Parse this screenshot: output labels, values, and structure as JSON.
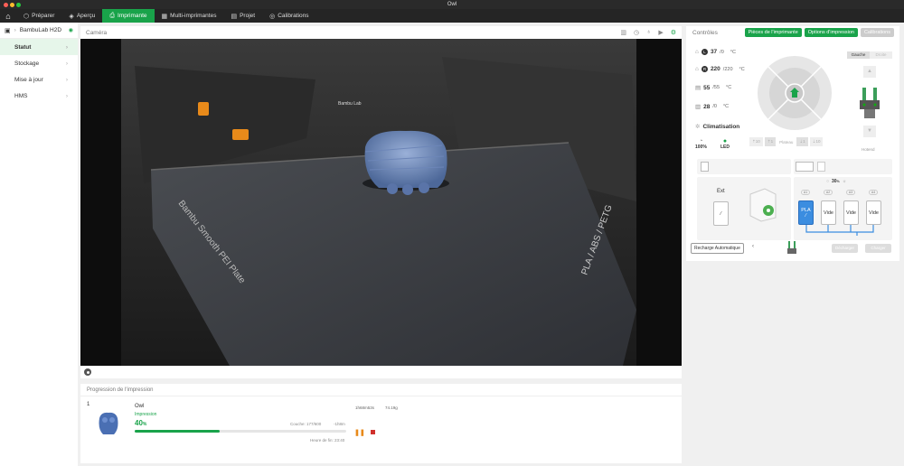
{
  "window": {
    "title": "Owl"
  },
  "nav": {
    "items": [
      {
        "label": "Préparer",
        "icon": "cube-icon"
      },
      {
        "label": "Aperçu",
        "icon": "layers-icon"
      },
      {
        "label": "Imprimante",
        "icon": "printer-icon",
        "active": true
      },
      {
        "label": "Multi-imprimantes",
        "icon": "grid-icon"
      },
      {
        "label": "Projet",
        "icon": "folder-icon"
      },
      {
        "label": "Calibrations",
        "icon": "target-icon"
      }
    ]
  },
  "sidebar": {
    "printer_name": "BambuLab H2D",
    "items": [
      {
        "label": "Statut",
        "active": true
      },
      {
        "label": "Stockage"
      },
      {
        "label": "Mise à jour"
      },
      {
        "label": "HMS"
      }
    ]
  },
  "camera": {
    "title": "Caméra",
    "bed_label": "Bambu Smooth PEI Plate",
    "bed_material": "PLA / ABS / PETG",
    "chamber_brand": "Bambu Lab"
  },
  "progress": {
    "title": "Progression de l'impression",
    "index": "1",
    "name": "Owl",
    "status": "Impression",
    "percent": "40",
    "percent_unit": "%",
    "percent_value": 40,
    "layer": "Couche: 177/600",
    "remaining": "-1h8m",
    "elapsed": "1h68m53s",
    "weight": "74.19g",
    "end_time": "Heure de fin: 23:40"
  },
  "controls": {
    "title": "Contrôles",
    "btn_parts": "Pièces de l'imprimante",
    "btn_options": "Options d'impression",
    "btn_calib": "Calibrations",
    "temps": [
      {
        "icon": "nozzle-left-icon",
        "value": "37",
        "target": "/0",
        "unit": "°C",
        "tag": "L"
      },
      {
        "icon": "nozzle-right-icon",
        "value": "220",
        "target": "/220",
        "unit": "°C",
        "tag": "R"
      },
      {
        "icon": "bed-icon",
        "value": "55",
        "target": "/55",
        "unit": "°C"
      },
      {
        "icon": "chamber-icon",
        "value": "28",
        "target": "/0",
        "unit": "°C"
      }
    ],
    "climate": "Climatisation",
    "fan": "100%",
    "led": "LED",
    "left_tab": "Gauche",
    "right_tab": "Droite",
    "plate_label": "Plateau",
    "z_labels": [
      "10",
      "1",
      "1",
      "10"
    ],
    "hotend_label": "Hotend",
    "ext_label": "Ext",
    "humidity_pct": "30",
    "humidity_unit": "%",
    "slots": [
      {
        "label": "PLA",
        "pct": "A1",
        "color": "#3b8de0"
      },
      {
        "label": "Vide",
        "pct": "A2"
      },
      {
        "label": "Vide",
        "pct": "A3"
      },
      {
        "label": "Vide",
        "pct": "A4"
      }
    ],
    "auto_reload": "Recharge Automatique",
    "unload": "Décharger",
    "load": "Charger"
  }
}
